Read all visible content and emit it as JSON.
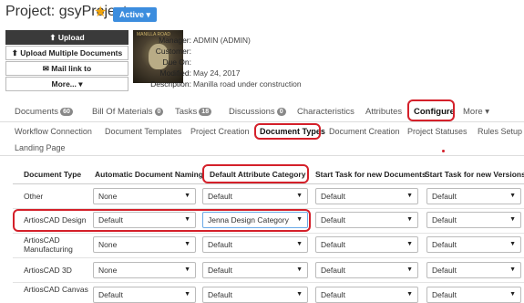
{
  "header": {
    "title": "Project:  gsyProject",
    "favorite_icon": "star-icon",
    "status_label": "Active ▾",
    "status_color": "#3c8dde"
  },
  "actions": {
    "upload": "⬆ Upload",
    "upload_multiple": "⬆ Upload Multiple Documents",
    "mail_link": "✉ Mail link to",
    "more": "More... ▾"
  },
  "thumbnail": {
    "caption": "MANILLA ROAD"
  },
  "meta": {
    "manager_key": "Manager:",
    "manager_val": "ADMIN (ADMIN)",
    "customer_key": "Customer:",
    "customer_val": "",
    "due_key": "Due On:",
    "due_val": "",
    "modified_key": "Modified:",
    "modified_val": "May 24, 2017",
    "desc_key": "Description:",
    "desc_val": "Manilla road under construction"
  },
  "tabs": [
    {
      "label": "Documents",
      "badge": "60"
    },
    {
      "label": "Bill Of Materials",
      "badge": "0"
    },
    {
      "label": "Tasks",
      "badge": "18"
    },
    {
      "label": "Discussions",
      "badge": "0"
    },
    {
      "label": "Characteristics",
      "badge": ""
    },
    {
      "label": "Attributes",
      "badge": ""
    },
    {
      "label": "Configure",
      "badge": ""
    },
    {
      "label": "More ▾",
      "badge": ""
    }
  ],
  "subtabs": [
    "Workflow Connection",
    "Document Templates",
    "Project Creation",
    "Document Types",
    "Document Creation",
    "Project Statuses",
    "Rules Setup",
    "Landing Page"
  ],
  "table": {
    "headers": [
      "Document Type",
      "Automatic Document Naming",
      "Default Attribute Category",
      "Start Task for new Documents",
      "Start Task for new Versions"
    ],
    "rows": [
      {
        "type": "Other",
        "naming": "None",
        "category": "Default",
        "start_docs": "Default",
        "start_versions": "Default"
      },
      {
        "type": "ArtiosCAD Design",
        "naming": "Default",
        "category": "Jenna Design Category",
        "start_docs": "Default",
        "start_versions": "Default"
      },
      {
        "type": "ArtiosCAD Manufacturing",
        "naming": "None",
        "category": "Default",
        "start_docs": "Default",
        "start_versions": "Default"
      },
      {
        "type": "ArtiosCAD 3D",
        "naming": "None",
        "category": "Default",
        "start_docs": "Default",
        "start_versions": "Default"
      },
      {
        "type": "ArtiosCAD Canvas",
        "naming": "Default",
        "category": "Default",
        "start_docs": "Default",
        "start_versions": "Default"
      }
    ]
  },
  "highlight_color": "#d4202a"
}
